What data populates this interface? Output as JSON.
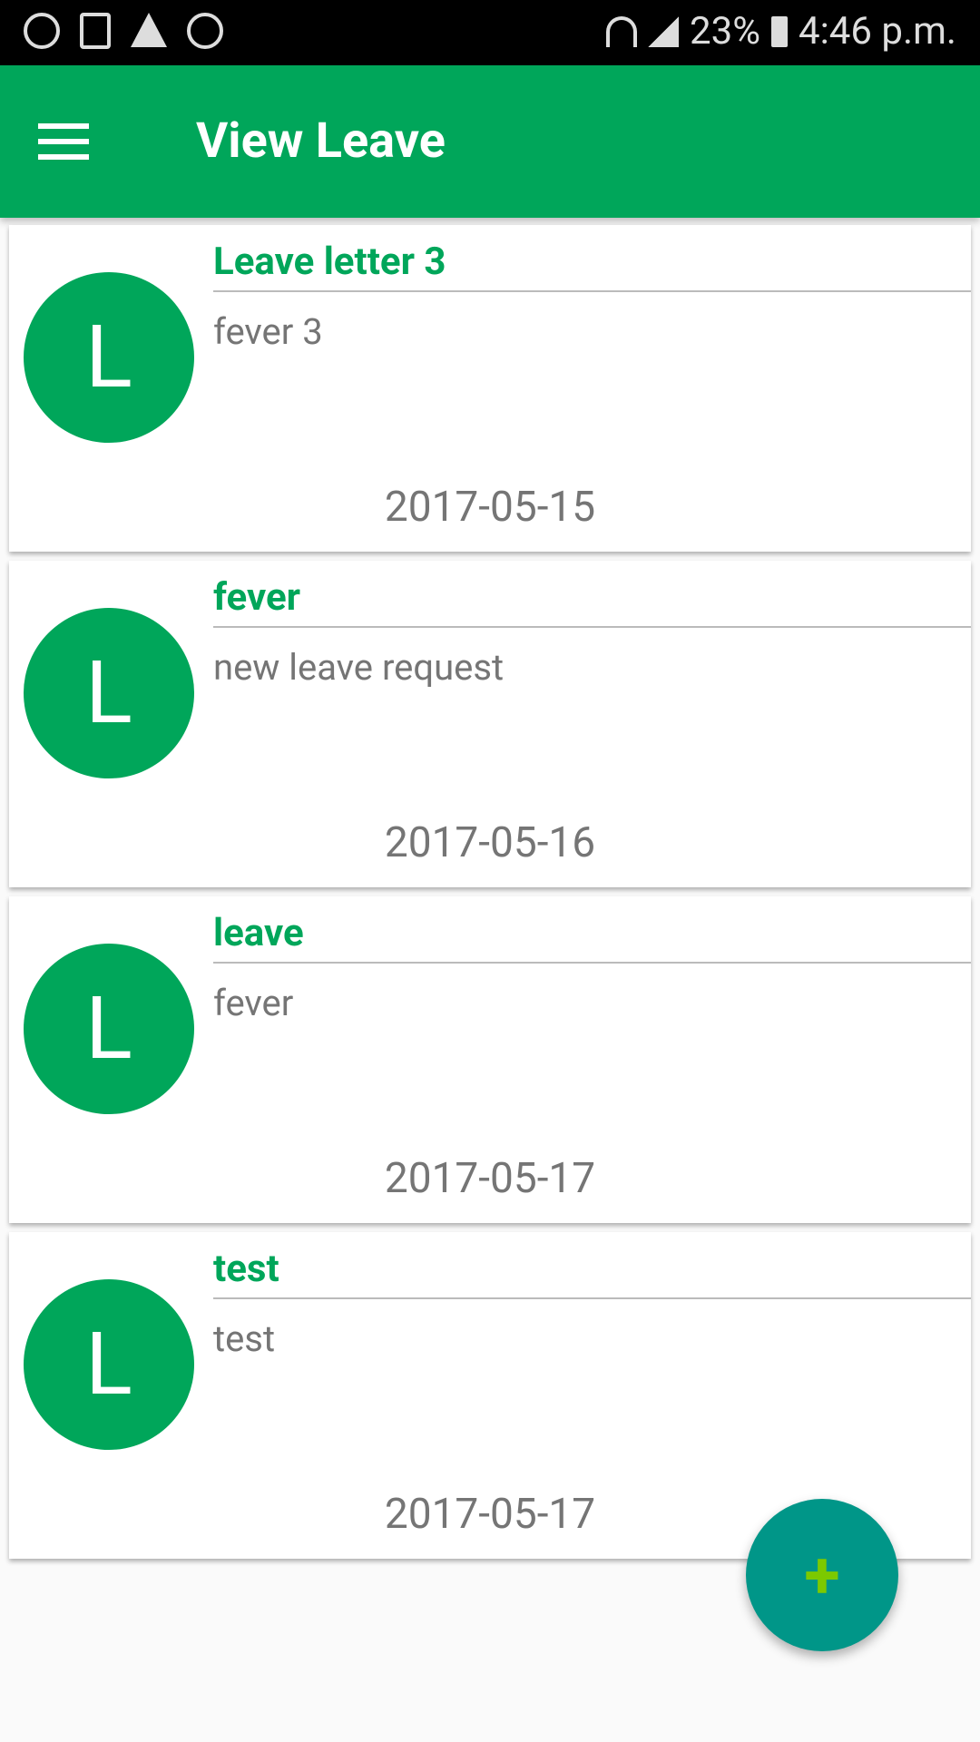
{
  "status_bar": {
    "battery": "23%",
    "time": "4:46 p.m.",
    "icons": [
      "whatsapp-icon",
      "gallery-icon",
      "warning-icon",
      "call-icon",
      "wifi-icon",
      "signal-icon",
      "battery-charging-icon"
    ]
  },
  "app_bar": {
    "title": "View Leave",
    "menu_icon": "hamburger-icon"
  },
  "leaves": [
    {
      "avatar": "L",
      "title": "Leave letter 3",
      "description": "fever 3",
      "date": "2017-05-15"
    },
    {
      "avatar": "L",
      "title": "fever",
      "description": "new leave request",
      "date": "2017-05-16"
    },
    {
      "avatar": "L",
      "title": "leave",
      "description": "fever",
      "date": "2017-05-17"
    },
    {
      "avatar": "L",
      "title": "test",
      "description": "test",
      "date": "2017-05-17"
    }
  ],
  "fab": {
    "label": "+",
    "icon": "plus-icon"
  },
  "colors": {
    "primary": "#00a65a",
    "fab": "#009688",
    "fab_icon": "#7cc900"
  }
}
